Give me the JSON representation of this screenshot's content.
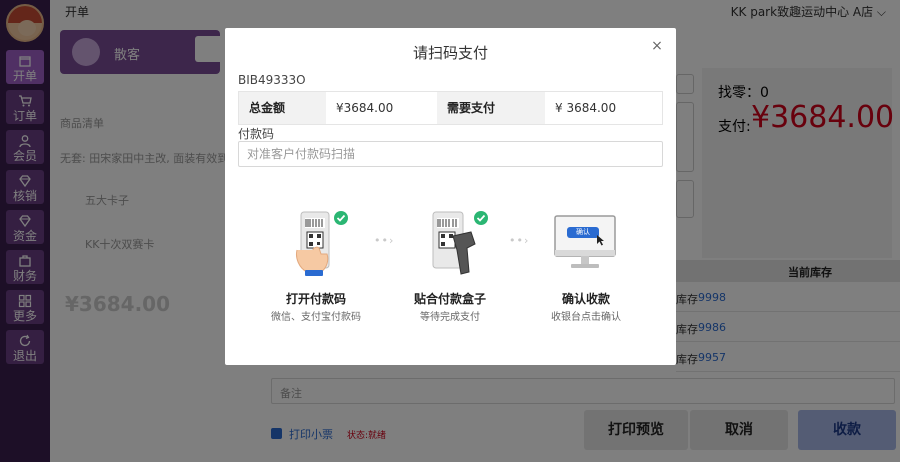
{
  "topbar": {
    "title": "开单",
    "store": "KK park致趣运动中心 A店 ⌵"
  },
  "sidebar": {
    "items": [
      {
        "label": "开单",
        "icon": "shop-icon"
      },
      {
        "label": "订单",
        "icon": "cart-icon"
      },
      {
        "label": "会员",
        "icon": "member-icon"
      },
      {
        "label": "核销",
        "icon": "diamond-icon"
      },
      {
        "label": "资金",
        "icon": "diamond-icon"
      },
      {
        "label": "财务",
        "icon": "bag-icon"
      },
      {
        "label": "更多",
        "icon": "grid-icon"
      },
      {
        "label": "退出",
        "icon": "refresh-icon"
      }
    ]
  },
  "background": {
    "customer_label": "散客",
    "product_list_label": "商品清单",
    "line1": "无套: 田宋家田中主改, 面装有效到",
    "line2": "五大卡子",
    "line3": "KK十次双赛卡",
    "total": "¥3684.00",
    "change_label": "找零：0",
    "pay_label": "支付:",
    "pay_amount": "¥3684.00",
    "inventory_header": "当前库存",
    "inventory_rows": [
      {
        "label": "库存",
        "value": "9998"
      },
      {
        "label": "库存",
        "value": "9986"
      },
      {
        "label": "库存",
        "value": "9957"
      }
    ],
    "remark_placeholder": "备注",
    "print_receipt": "打印小票",
    "status": "状态:就绪",
    "buttons": {
      "preview": "打印预览",
      "cancel": "取消",
      "collect": "收款"
    }
  },
  "modal": {
    "title": "请扫码支付",
    "close": "×",
    "order_no": "BIB49333O",
    "total_label": "总金额",
    "total_value": "¥3684.00",
    "due_label": "需要支付",
    "due_value": "¥ 3684.00",
    "code_label": "付款码",
    "code_placeholder": "对准客户付款码扫描",
    "steps": [
      {
        "title": "打开付款码",
        "desc": "微信、支付宝付款码"
      },
      {
        "title": "贴合付款盒子",
        "desc": "等待完成支付"
      },
      {
        "title": "确认收款",
        "desc": "收银台点击确认"
      }
    ],
    "confirm_badge": "确认"
  },
  "colors": {
    "sidebar": "#3a1f4f",
    "accent_purple": "#a160c9",
    "price_red": "#d0021b",
    "link_blue": "#2a6bd1",
    "check_green": "#2bb673"
  }
}
